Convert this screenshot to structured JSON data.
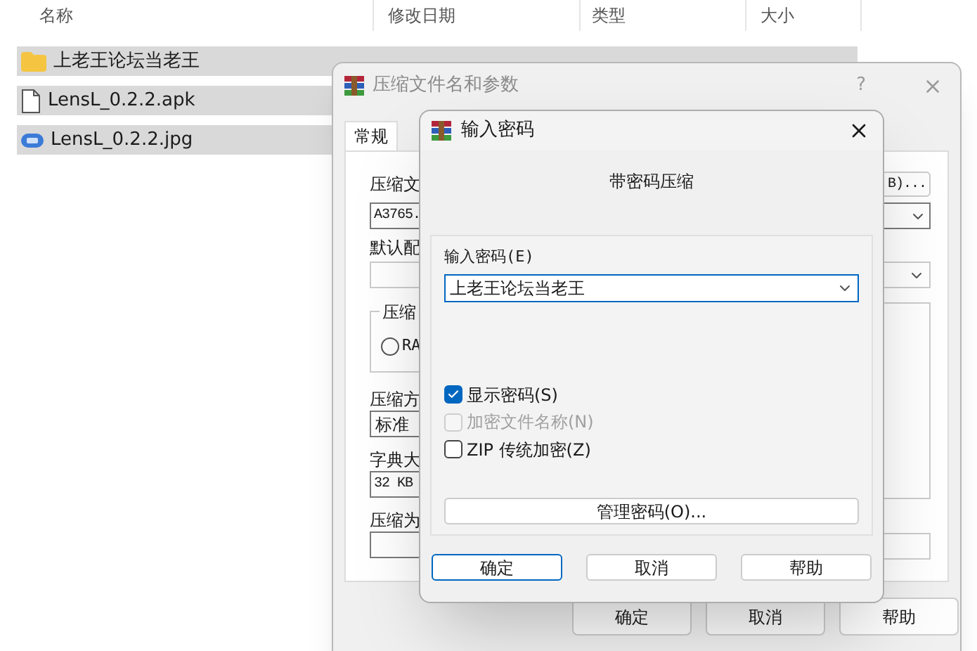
{
  "file_list": {
    "columns": [
      "名称",
      "修改日期",
      "类型",
      "大小"
    ],
    "rows": [
      {
        "kind": "folder",
        "name": "上老王论坛当老王",
        "selected": true
      },
      {
        "kind": "file",
        "name": "LensL_0.2.2.apk",
        "selected": true
      },
      {
        "kind": "image",
        "name": "LensL_0.2.2.jpg",
        "selected": true
      }
    ]
  },
  "archive_dialog": {
    "title": "压缩文件名和参数",
    "help_glyph": "?",
    "tabs": [
      {
        "label": "常规",
        "selected": true
      }
    ],
    "archive_name_label": "压缩文",
    "archive_name_value": "A3765.",
    "browse_button": "B)...",
    "profile_label": "默认配",
    "format_group_label": "压缩",
    "format_options": [
      {
        "label": "RA",
        "selected": false
      }
    ],
    "method_label": "压缩方",
    "method_value": "标准",
    "dictionary_label": "字典大",
    "dictionary_value": "32 KB",
    "split_label": "压缩为",
    "buttons": [
      "确定",
      "取消",
      "帮助"
    ]
  },
  "password_dialog": {
    "title": "输入密码",
    "heading": "带密码压缩",
    "password_label": "输入密码(E)",
    "password_value": "上老王论坛当老王",
    "options": [
      {
        "label": "显示密码(S)",
        "checked": true,
        "disabled": false
      },
      {
        "label": "加密文件名称(N)",
        "checked": false,
        "disabled": true
      },
      {
        "label": "ZIP 传统加密(Z)",
        "checked": false,
        "disabled": false
      }
    ],
    "manage_button": "管理密码(O)...",
    "buttons": [
      {
        "label": "确定",
        "focused": true
      },
      {
        "label": "取消",
        "focused": false
      },
      {
        "label": "帮助",
        "focused": false
      }
    ]
  }
}
